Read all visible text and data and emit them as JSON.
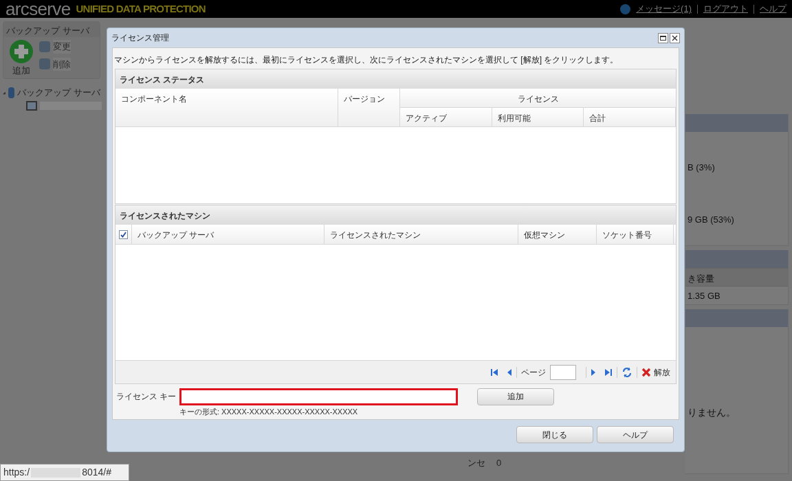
{
  "header": {
    "logo": "arcserve",
    "tagline": "UNIFIED DATA PROTECTION",
    "links": [
      "メッセージ(1)",
      "ログアウト",
      "ヘルプ"
    ]
  },
  "ribbon": {
    "group_title": "バックアップ サーバ",
    "buttons": [
      {
        "label": "追加",
        "kind": "large",
        "disabled": false
      },
      {
        "label": "変更",
        "kind": "small",
        "disabled": true
      },
      {
        "label": "削除",
        "kind": "small",
        "disabled": true
      }
    ]
  },
  "tree": {
    "label": "バックアップ サーバ",
    "expanded": true
  },
  "background": {
    "texts": [
      "B (3%)",
      "9 GB (53%)"
    ],
    "table_header": "き容量",
    "table_cell": "1.35 GB",
    "message": "りません。",
    "row_label": "ンセ",
    "row_value": "0"
  },
  "status_url": [
    "https:/",
    "8014/#"
  ],
  "dialog": {
    "title": "ライセンス管理",
    "instruction": "マシンからライセンスを解放するには、最初にライセンスを選択し、次にライセンスされたマシンを選択して [解放] をクリックします。",
    "license_status": {
      "title": "ライセンス ステータス",
      "columns": [
        "コンポーネント名",
        "バージョン"
      ],
      "group_header": "ライセンス",
      "sub_columns": [
        "アクティブ",
        "利用可能",
        "合計"
      ]
    },
    "licensed_machines": {
      "title": "ライセンスされたマシン",
      "select_all_checked": true,
      "columns": [
        "バックアップ サーバ",
        "ライセンスされたマシン",
        "仮想マシン",
        "ソケット番号"
      ]
    },
    "pager": {
      "page_label": "ページ",
      "release_label": "解放"
    },
    "license_key": {
      "label": "ライセンス キー",
      "placeholder_hint": "キーの形式: XXXXX-XXXXX-XXXXX-XXXXX-XXXXX",
      "highlighted": true
    },
    "add_button": "追加",
    "buttons": [
      "閉じる",
      "ヘルプ"
    ]
  }
}
